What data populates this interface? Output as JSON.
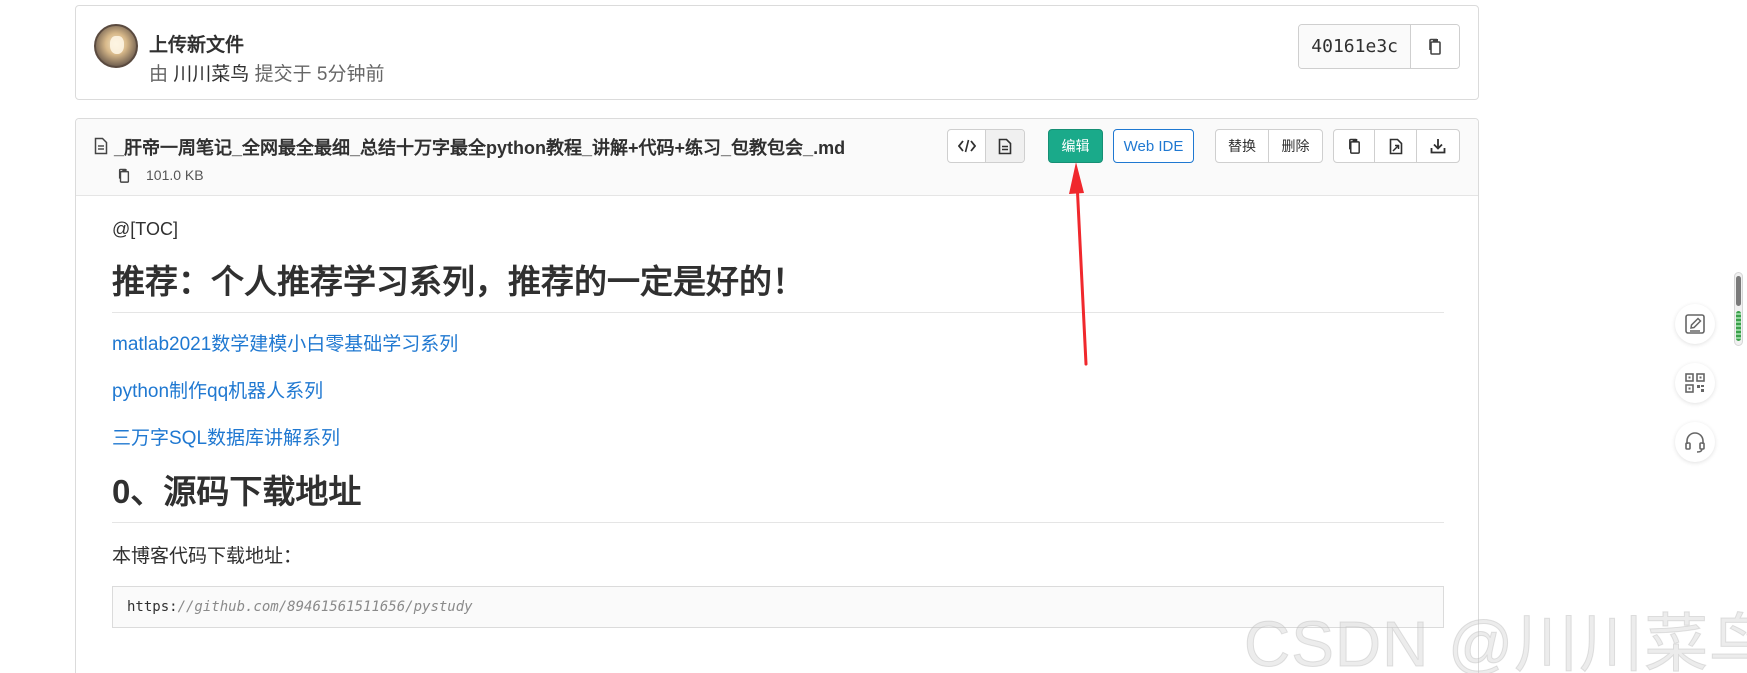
{
  "commit": {
    "title": "上传新文件",
    "meta_prefix": "由",
    "author": "川川菜鸟",
    "meta_suffix": "提交于 5分钟前",
    "sha": "40161e3c"
  },
  "file": {
    "name": "_肝帝一周笔记_全网最全最细_总结十万字最全python教程_讲解+代码+练习_包教包会_.md",
    "size": "101.0 KB"
  },
  "toolbar": {
    "edit_label": "编辑",
    "webide_label": "Web IDE",
    "replace_label": "替换",
    "delete_label": "删除"
  },
  "content": {
    "toc": "@[TOC]",
    "heading1": "推荐：个人推荐学习系列，推荐的一定是好的！",
    "links": [
      "matlab2021数学建模小白零基础学习系列",
      "python制作qq机器人系列",
      "三万字SQL数据库讲解系列"
    ],
    "heading2": "0、源码下载地址",
    "para": "本博客代码下载地址：",
    "code_proto": "https:",
    "code_rest": "//github.com/89461561511656/pystudy"
  },
  "watermark": "CSDN @川川菜鸟",
  "colors": {
    "accent_green": "#1aaa8a",
    "link_blue": "#1f78d1",
    "annotation_red": "#f0282d"
  }
}
